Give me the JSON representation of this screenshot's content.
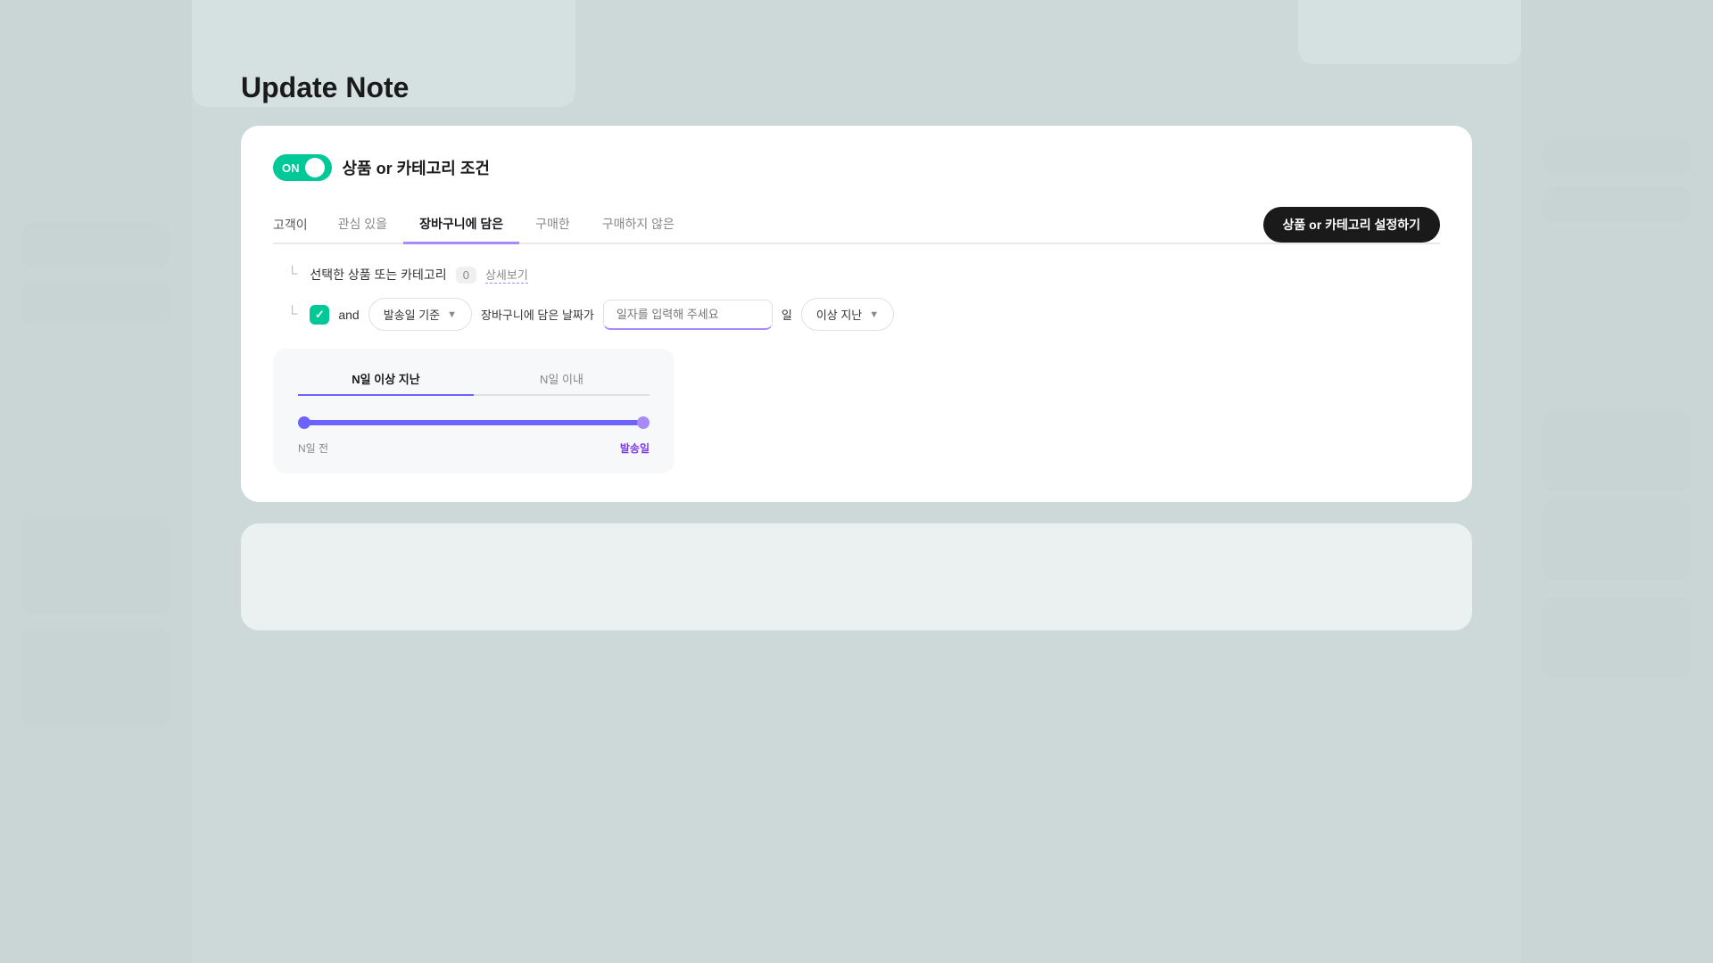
{
  "page": {
    "title": "Update Note",
    "bg_color": "#cdd9d9"
  },
  "toggle": {
    "label_on": "ON",
    "panel_title": "상품 or 카테고리 조건"
  },
  "tabs": {
    "prefix_label": "고객이",
    "items": [
      {
        "label": "관심 있을",
        "active": false
      },
      {
        "label": "장바구니에 담은",
        "active": true
      },
      {
        "label": "구매한",
        "active": false
      },
      {
        "label": "구매하지 않은",
        "active": false
      }
    ],
    "action_button": "상품 or 카테고리 설정하기"
  },
  "condition_row1": {
    "indent": "└",
    "text": "선택한 상품 또는 카테고리",
    "count": "0",
    "detail_link": "상세보기"
  },
  "and_row": {
    "indent": "└",
    "check": "✓",
    "and_text": "and",
    "dropdown1_label": "발송일 기준",
    "mid_text": "장바구니에 담은 날짜가",
    "input_placeholder": "일자를 입력해 주세요",
    "day_text": "일",
    "dropdown2_label": "이상 지난"
  },
  "timeline": {
    "tab_left": "N일 이상 지난",
    "tab_right": "N일 이내",
    "label_left": "N일 전",
    "label_right": "발송일"
  }
}
